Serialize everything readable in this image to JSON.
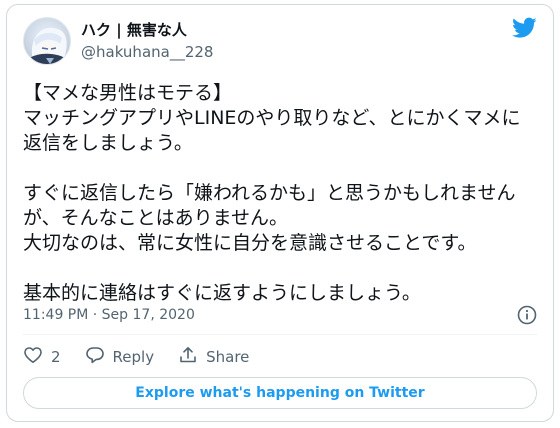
{
  "tweet": {
    "author": {
      "display_name": "ハク | 無害な人",
      "handle": "@hakuhana__228",
      "avatar_icon": "avatar-illustration"
    },
    "text": "【マメな男性はモテる】\nマッチングアプリやLINEのやり取りなど、とにかくマメに返信をしましょう。\n\nすぐに返信したら「嫌われるかも」と思うかもしれませんが、そんなことはありません。\n大切なのは、常に女性に自分を意識させることです。\n\n基本的に連絡はすぐに返すようにしましょう。",
    "timestamp": "11:49 PM · Sep 17, 2020",
    "actions": {
      "like_count": "2",
      "reply_label": "Reply",
      "share_label": "Share"
    },
    "explore_label": "Explore what's happening on Twitter"
  },
  "icons": {
    "brand": "twitter-bird-icon",
    "info": "info-icon",
    "like": "heart-icon",
    "reply": "reply-bubble-icon",
    "share": "share-icon"
  },
  "colors": {
    "twitter_blue": "#1d9bf0",
    "text_primary": "#0f1419",
    "text_secondary": "#536471",
    "border": "#cfd9de"
  }
}
